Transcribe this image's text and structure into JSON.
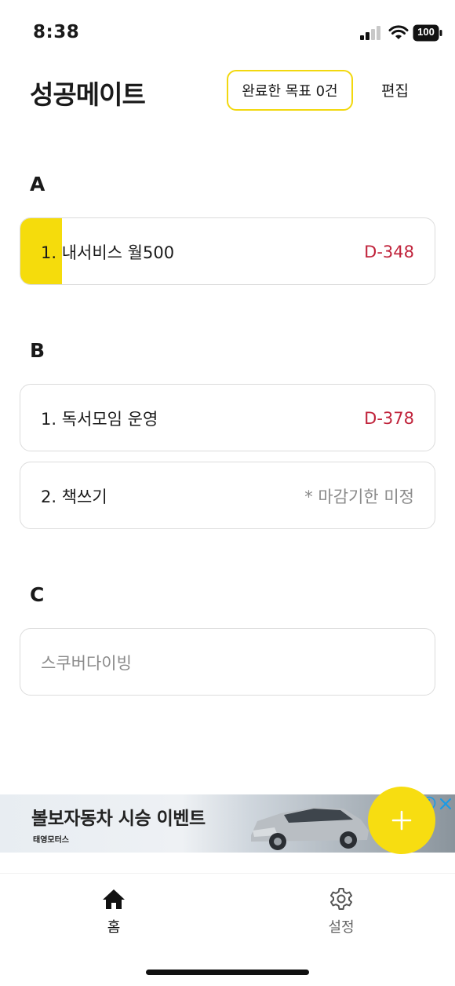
{
  "status_bar": {
    "time": "8:38",
    "battery": "100"
  },
  "header": {
    "title": "성공메이트",
    "completed_badge": "완료한 목표 0건",
    "edit_label": "편집"
  },
  "sections": [
    {
      "label": "A",
      "goals": [
        {
          "title": "1. 내서비스 월500",
          "deadline": "D-348",
          "progress": 0.1
        }
      ]
    },
    {
      "label": "B",
      "goals": [
        {
          "title": "1. 독서모임 운영",
          "deadline": "D-378"
        },
        {
          "title": "2. 책쓰기",
          "deadline": "* 마감기한 미정"
        }
      ]
    },
    {
      "label": "C",
      "goals": [
        {
          "title": "스쿠버다이빙"
        }
      ]
    }
  ],
  "ad": {
    "headline": "볼보자동차 시승 이벤트",
    "sub": "태영모터스"
  },
  "tabs": [
    {
      "label": "홈"
    },
    {
      "label": "설정"
    }
  ],
  "colors": {
    "accent": "#f5dc0c",
    "deadline": "#c0233b",
    "muted": "#8a8a8a"
  }
}
